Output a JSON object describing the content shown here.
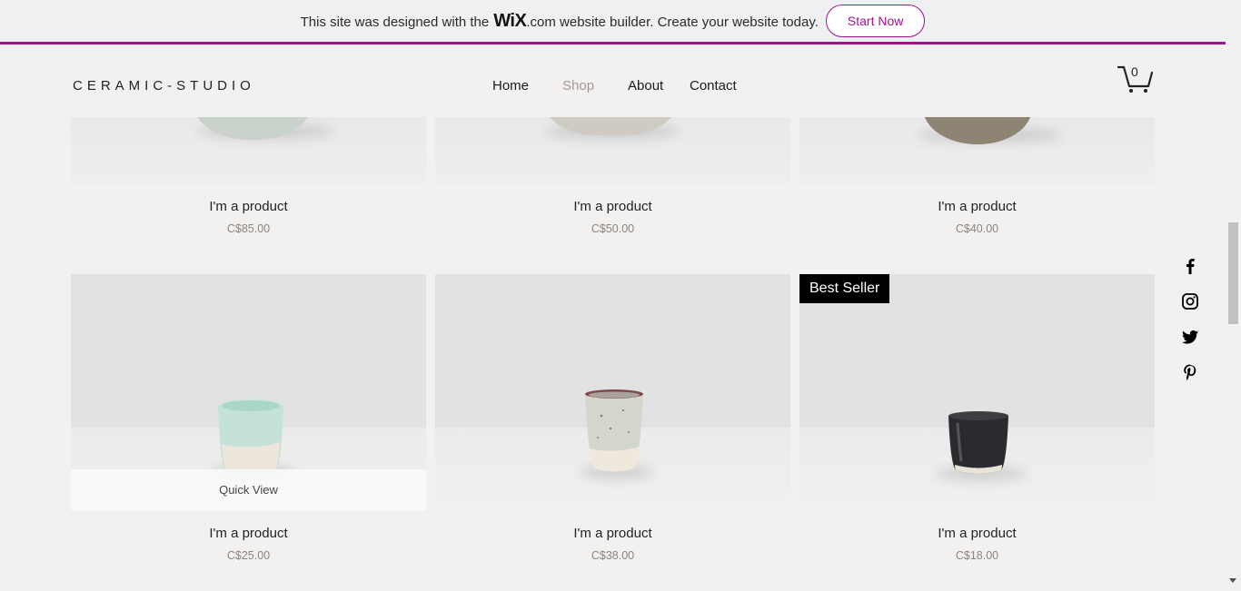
{
  "banner": {
    "text_before": "This site was designed with the",
    "logo": "WiX",
    "text_after": ".com website builder. Create your website today.",
    "button_label": "Start Now",
    "accent_color": "#a0138e"
  },
  "header": {
    "brand": "CERAMIC-STUDIO",
    "nav": [
      "Home",
      "Shop",
      "About",
      "Contact"
    ],
    "active_nav": "Shop",
    "cart_count": "0"
  },
  "products_top": [
    {
      "title": "I'm a product",
      "price": "C$85.00"
    },
    {
      "title": "I'm a product",
      "price": "C$50.00"
    },
    {
      "title": "I'm a product",
      "price": "C$40.00"
    }
  ],
  "products_bottom": [
    {
      "title": "I'm a product",
      "price": "C$25.00",
      "overlay": "Quick View"
    },
    {
      "title": "I'm a product",
      "price": "C$38.00"
    },
    {
      "title": "I'm a product",
      "price": "C$18.00",
      "ribbon": "Best Seller"
    }
  ],
  "social": [
    "facebook-icon",
    "instagram-icon",
    "twitter-icon",
    "pinterest-icon"
  ]
}
